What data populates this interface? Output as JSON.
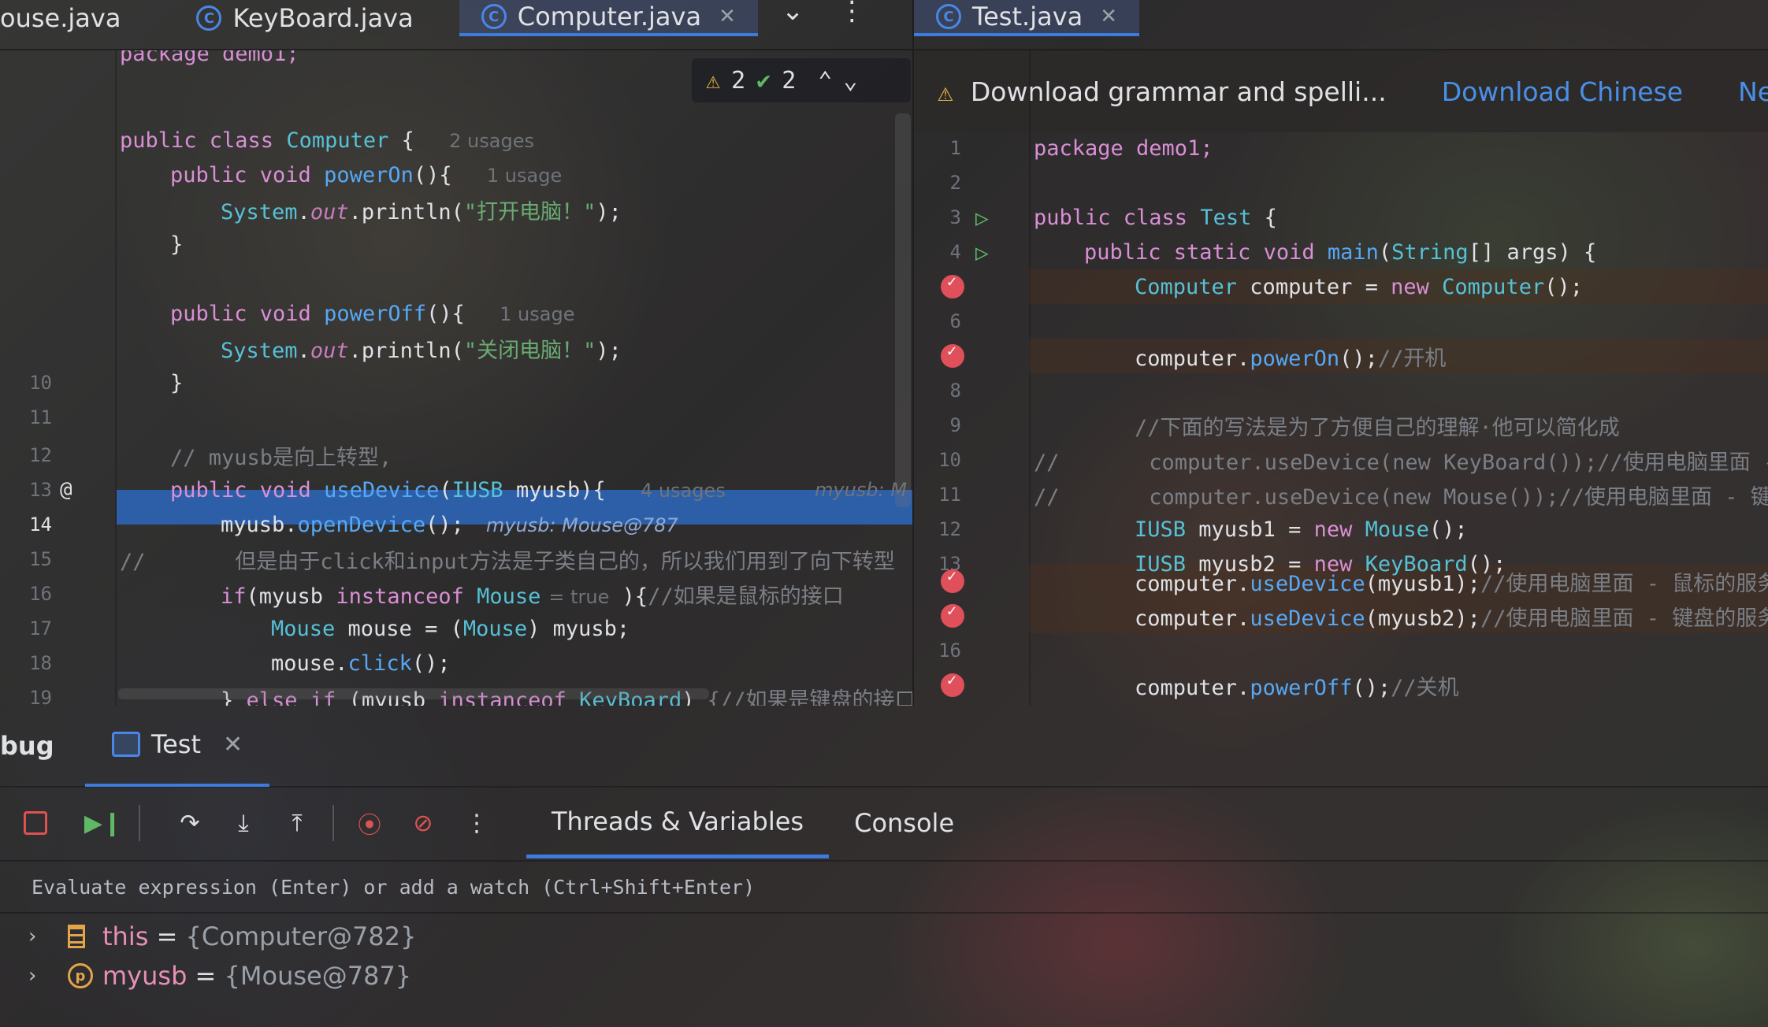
{
  "left_tabs": [
    {
      "label": "ouse.java",
      "active": false,
      "icon": "class-icon"
    },
    {
      "label": "KeyBoard.java",
      "active": false,
      "icon": "class-icon"
    },
    {
      "label": "Computer.java",
      "active": true,
      "icon": "class-icon"
    }
  ],
  "right_tabs": [
    {
      "label": "Test.java",
      "active": true,
      "icon": "class-icon"
    }
  ],
  "inspections": {
    "warnings": "2",
    "ok": "2"
  },
  "notification": {
    "text": "Download grammar and spelli...",
    "action1": "Download Chinese",
    "action2": "Never s"
  },
  "left_code": [
    {
      "num": "",
      "kind": "pkg",
      "text": "package demo1;"
    },
    {
      "num": "",
      "kind": "blank"
    },
    {
      "num": "",
      "kind": "class",
      "hint": "2 usages"
    },
    {
      "num": "",
      "kind": "method_on",
      "hint": "1 usage"
    },
    {
      "num": "",
      "kind": "print_on",
      "str": "\"打开电脑！\""
    },
    {
      "num": "",
      "kind": "close1"
    },
    {
      "num": "",
      "kind": "blank"
    },
    {
      "num": "",
      "kind": "method_off",
      "hint": "1 usage"
    },
    {
      "num": "",
      "kind": "print_off",
      "str": "\"关闭电脑！\""
    },
    {
      "num": "10",
      "kind": "close1"
    },
    {
      "num": "11",
      "kind": "blank"
    },
    {
      "num": "12",
      "kind": "comment1",
      "text": "// myusb是向上转型,"
    },
    {
      "num": "13",
      "kind": "usedev",
      "hint": "4 usages",
      "inline": "myusb: M"
    },
    {
      "num": "14",
      "kind": "opendev",
      "inline": "myusb: Mouse@787"
    },
    {
      "num": "15",
      "kind": "comment2",
      "text": "//       但是由于click和input方法是子类自己的，所以我们用到了向下转型"
    },
    {
      "num": "16",
      "kind": "iftest",
      "hint": "= true",
      "comment": "//如果是鼠标的接口"
    },
    {
      "num": "17",
      "kind": "mousedecl"
    },
    {
      "num": "18",
      "kind": "click"
    },
    {
      "num": "19",
      "kind": "elseif",
      "comment": "{//如果是键盘的接口"
    }
  ],
  "right_code": [
    {
      "num": "1",
      "kind": "pkg",
      "text": "package demo1;"
    },
    {
      "num": "2",
      "kind": "blank"
    },
    {
      "num": "3",
      "kind": "class_test"
    },
    {
      "num": "4",
      "kind": "main"
    },
    {
      "num": "",
      "kind": "newcomp"
    },
    {
      "num": "6",
      "kind": "blank"
    },
    {
      "num": "",
      "kind": "poweron",
      "comment": "//开机"
    },
    {
      "num": "8",
      "kind": "blank"
    },
    {
      "num": "9",
      "kind": "cmt",
      "text": "//下面的写法是为了方便自己的理解·他可以简化成"
    },
    {
      "num": "10",
      "kind": "cmtcode",
      "text": "//       computer.useDevice(new KeyBoard());//使用电脑里面 -"
    },
    {
      "num": "11",
      "kind": "cmtcode",
      "text": "//       computer.useDevice(new Mouse());//使用电脑里面 - 键"
    },
    {
      "num": "12",
      "kind": "usb1"
    },
    {
      "num": "13",
      "kind": "usb2"
    },
    {
      "num": "",
      "kind": "use1",
      "comment": "//使用电脑里面 - 鼠标的服务"
    },
    {
      "num": "",
      "kind": "use2",
      "comment": "//使用电脑里面 - 键盘的服务"
    },
    {
      "num": "16",
      "kind": "blank"
    },
    {
      "num": "",
      "kind": "poweroff",
      "comment": "//关机"
    }
  ],
  "debug": {
    "title": "bug",
    "session_tab": "Test",
    "subtabs": [
      "Threads & Variables",
      "Console"
    ],
    "eval_placeholder": "Evaluate expression (Enter) or add a watch (Ctrl+Shift+Enter)",
    "variables": [
      {
        "name": "this",
        "value": "{Computer@782}",
        "icon": "stack-icon"
      },
      {
        "name": "myusb",
        "value": "{Mouse@787}",
        "icon": "parameter-icon"
      }
    ]
  },
  "colors": {
    "accent": "#3d7bdc",
    "highlight": "#2c5fa8",
    "breakpoint": "#e0505a"
  }
}
